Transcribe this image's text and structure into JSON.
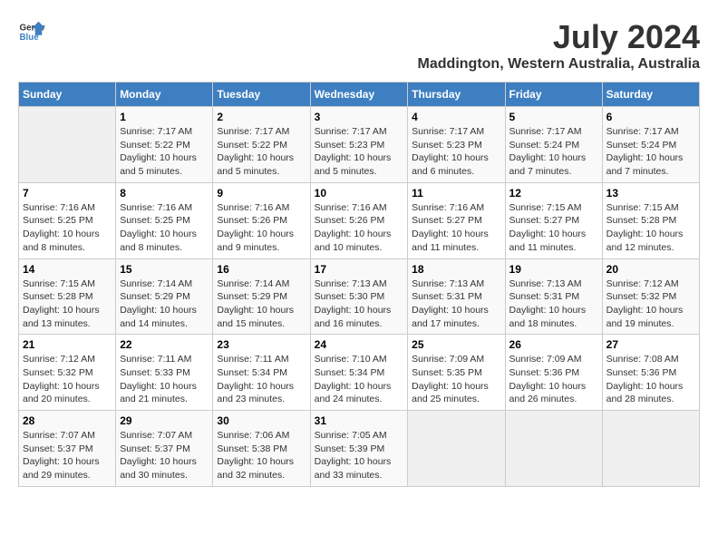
{
  "logo": {
    "line1": "General",
    "line2": "Blue"
  },
  "title": "July 2024",
  "subtitle": "Maddington, Western Australia, Australia",
  "headers": [
    "Sunday",
    "Monday",
    "Tuesday",
    "Wednesday",
    "Thursday",
    "Friday",
    "Saturday"
  ],
  "weeks": [
    [
      {
        "day": "",
        "sunrise": "",
        "sunset": "",
        "daylight": ""
      },
      {
        "day": "1",
        "sunrise": "Sunrise: 7:17 AM",
        "sunset": "Sunset: 5:22 PM",
        "daylight": "Daylight: 10 hours and 5 minutes."
      },
      {
        "day": "2",
        "sunrise": "Sunrise: 7:17 AM",
        "sunset": "Sunset: 5:22 PM",
        "daylight": "Daylight: 10 hours and 5 minutes."
      },
      {
        "day": "3",
        "sunrise": "Sunrise: 7:17 AM",
        "sunset": "Sunset: 5:23 PM",
        "daylight": "Daylight: 10 hours and 5 minutes."
      },
      {
        "day": "4",
        "sunrise": "Sunrise: 7:17 AM",
        "sunset": "Sunset: 5:23 PM",
        "daylight": "Daylight: 10 hours and 6 minutes."
      },
      {
        "day": "5",
        "sunrise": "Sunrise: 7:17 AM",
        "sunset": "Sunset: 5:24 PM",
        "daylight": "Daylight: 10 hours and 7 minutes."
      },
      {
        "day": "6",
        "sunrise": "Sunrise: 7:17 AM",
        "sunset": "Sunset: 5:24 PM",
        "daylight": "Daylight: 10 hours and 7 minutes."
      }
    ],
    [
      {
        "day": "7",
        "sunrise": "Sunrise: 7:16 AM",
        "sunset": "Sunset: 5:25 PM",
        "daylight": "Daylight: 10 hours and 8 minutes."
      },
      {
        "day": "8",
        "sunrise": "Sunrise: 7:16 AM",
        "sunset": "Sunset: 5:25 PM",
        "daylight": "Daylight: 10 hours and 8 minutes."
      },
      {
        "day": "9",
        "sunrise": "Sunrise: 7:16 AM",
        "sunset": "Sunset: 5:26 PM",
        "daylight": "Daylight: 10 hours and 9 minutes."
      },
      {
        "day": "10",
        "sunrise": "Sunrise: 7:16 AM",
        "sunset": "Sunset: 5:26 PM",
        "daylight": "Daylight: 10 hours and 10 minutes."
      },
      {
        "day": "11",
        "sunrise": "Sunrise: 7:16 AM",
        "sunset": "Sunset: 5:27 PM",
        "daylight": "Daylight: 10 hours and 11 minutes."
      },
      {
        "day": "12",
        "sunrise": "Sunrise: 7:15 AM",
        "sunset": "Sunset: 5:27 PM",
        "daylight": "Daylight: 10 hours and 11 minutes."
      },
      {
        "day": "13",
        "sunrise": "Sunrise: 7:15 AM",
        "sunset": "Sunset: 5:28 PM",
        "daylight": "Daylight: 10 hours and 12 minutes."
      }
    ],
    [
      {
        "day": "14",
        "sunrise": "Sunrise: 7:15 AM",
        "sunset": "Sunset: 5:28 PM",
        "daylight": "Daylight: 10 hours and 13 minutes."
      },
      {
        "day": "15",
        "sunrise": "Sunrise: 7:14 AM",
        "sunset": "Sunset: 5:29 PM",
        "daylight": "Daylight: 10 hours and 14 minutes."
      },
      {
        "day": "16",
        "sunrise": "Sunrise: 7:14 AM",
        "sunset": "Sunset: 5:29 PM",
        "daylight": "Daylight: 10 hours and 15 minutes."
      },
      {
        "day": "17",
        "sunrise": "Sunrise: 7:13 AM",
        "sunset": "Sunset: 5:30 PM",
        "daylight": "Daylight: 10 hours and 16 minutes."
      },
      {
        "day": "18",
        "sunrise": "Sunrise: 7:13 AM",
        "sunset": "Sunset: 5:31 PM",
        "daylight": "Daylight: 10 hours and 17 minutes."
      },
      {
        "day": "19",
        "sunrise": "Sunrise: 7:13 AM",
        "sunset": "Sunset: 5:31 PM",
        "daylight": "Daylight: 10 hours and 18 minutes."
      },
      {
        "day": "20",
        "sunrise": "Sunrise: 7:12 AM",
        "sunset": "Sunset: 5:32 PM",
        "daylight": "Daylight: 10 hours and 19 minutes."
      }
    ],
    [
      {
        "day": "21",
        "sunrise": "Sunrise: 7:12 AM",
        "sunset": "Sunset: 5:32 PM",
        "daylight": "Daylight: 10 hours and 20 minutes."
      },
      {
        "day": "22",
        "sunrise": "Sunrise: 7:11 AM",
        "sunset": "Sunset: 5:33 PM",
        "daylight": "Daylight: 10 hours and 21 minutes."
      },
      {
        "day": "23",
        "sunrise": "Sunrise: 7:11 AM",
        "sunset": "Sunset: 5:34 PM",
        "daylight": "Daylight: 10 hours and 23 minutes."
      },
      {
        "day": "24",
        "sunrise": "Sunrise: 7:10 AM",
        "sunset": "Sunset: 5:34 PM",
        "daylight": "Daylight: 10 hours and 24 minutes."
      },
      {
        "day": "25",
        "sunrise": "Sunrise: 7:09 AM",
        "sunset": "Sunset: 5:35 PM",
        "daylight": "Daylight: 10 hours and 25 minutes."
      },
      {
        "day": "26",
        "sunrise": "Sunrise: 7:09 AM",
        "sunset": "Sunset: 5:36 PM",
        "daylight": "Daylight: 10 hours and 26 minutes."
      },
      {
        "day": "27",
        "sunrise": "Sunrise: 7:08 AM",
        "sunset": "Sunset: 5:36 PM",
        "daylight": "Daylight: 10 hours and 28 minutes."
      }
    ],
    [
      {
        "day": "28",
        "sunrise": "Sunrise: 7:07 AM",
        "sunset": "Sunset: 5:37 PM",
        "daylight": "Daylight: 10 hours and 29 minutes."
      },
      {
        "day": "29",
        "sunrise": "Sunrise: 7:07 AM",
        "sunset": "Sunset: 5:37 PM",
        "daylight": "Daylight: 10 hours and 30 minutes."
      },
      {
        "day": "30",
        "sunrise": "Sunrise: 7:06 AM",
        "sunset": "Sunset: 5:38 PM",
        "daylight": "Daylight: 10 hours and 32 minutes."
      },
      {
        "day": "31",
        "sunrise": "Sunrise: 7:05 AM",
        "sunset": "Sunset: 5:39 PM",
        "daylight": "Daylight: 10 hours and 33 minutes."
      },
      {
        "day": "",
        "sunrise": "",
        "sunset": "",
        "daylight": ""
      },
      {
        "day": "",
        "sunrise": "",
        "sunset": "",
        "daylight": ""
      },
      {
        "day": "",
        "sunrise": "",
        "sunset": "",
        "daylight": ""
      }
    ]
  ],
  "colors": {
    "header_bg": "#3e7fc1",
    "header_text": "#ffffff",
    "odd_row": "#f9f9f9",
    "even_row": "#ffffff",
    "empty_cell": "#f0f0f0"
  }
}
